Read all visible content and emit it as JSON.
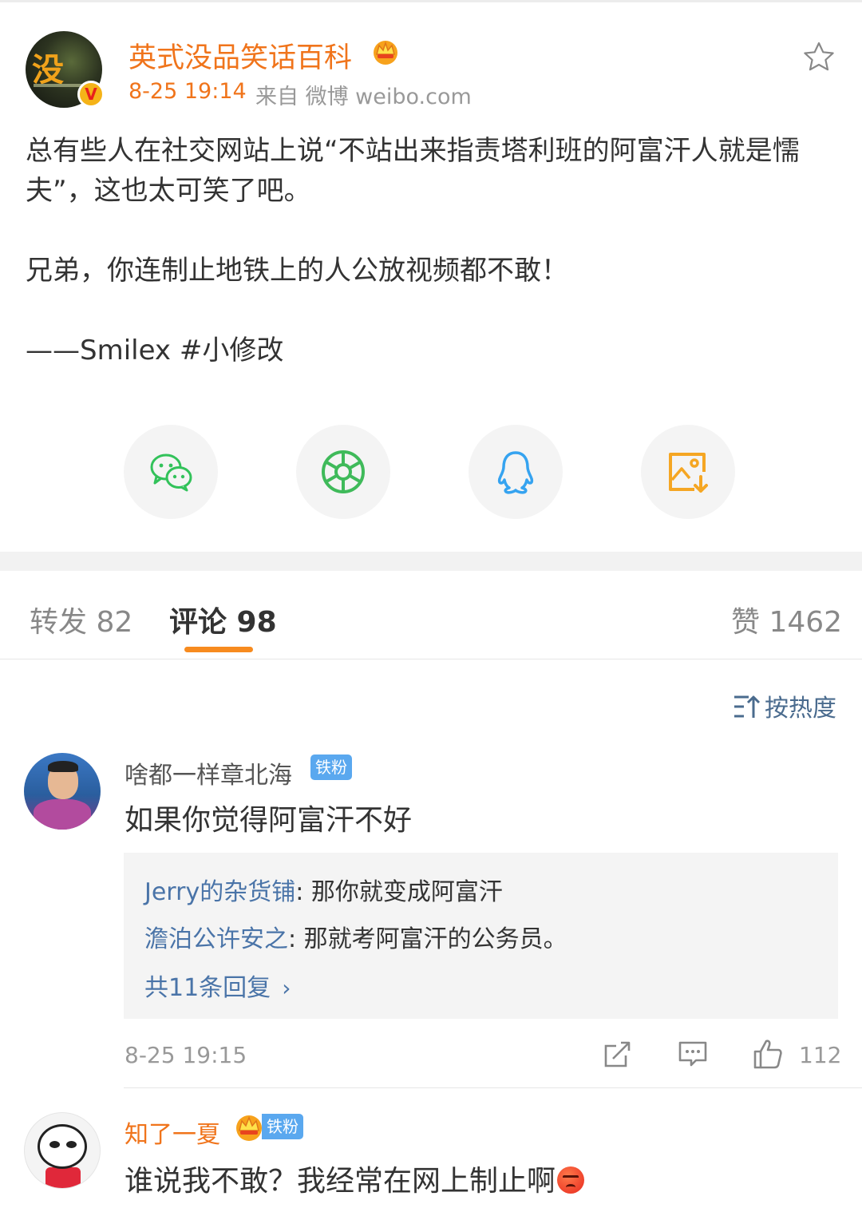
{
  "post": {
    "author": "英式没品笑话百科",
    "avatar_text": "没",
    "verified_mark": "V",
    "time": "8-25 19:14",
    "source": "来自 微博 weibo.com",
    "body": [
      "总有些人在社交网站上说“不站出来指责塔利班的阿富汗人就是懦夫”，这也太可笑了吧。",
      "兄弟，你连制止地铁上的人公放视频都不敢！",
      "——Smilex #小修改"
    ]
  },
  "share": {
    "icons": [
      "wechat-icon",
      "moments-icon",
      "qq-icon",
      "save-image-icon"
    ]
  },
  "tabs": {
    "repost": "转发 82",
    "comments": "评论 98",
    "likes": "赞 1462"
  },
  "sort": {
    "label": "按热度"
  },
  "comments": [
    {
      "user": "啥都一样章北海",
      "badge": "铁粉",
      "text": "如果你觉得阿富汗不好",
      "replies": [
        {
          "user": "Jerry的杂货铺",
          "text": ": 那你就变成阿富汗"
        },
        {
          "user": "澹泊公许安之",
          "text": ": 那就考阿富汗的公务员。"
        }
      ],
      "more_replies": "共11条回复",
      "time": "8-25 19:15",
      "likes": "112"
    },
    {
      "user": "知了一夏",
      "badge": "铁粉",
      "text": "谁说我不敢？我经常在网上制止啊"
    }
  ],
  "colors": {
    "accent_orange": "#f0741b",
    "link_blue": "#4a74a8",
    "badge_blue": "#5aa8ef",
    "tab_indicator": "#f78b1f"
  }
}
